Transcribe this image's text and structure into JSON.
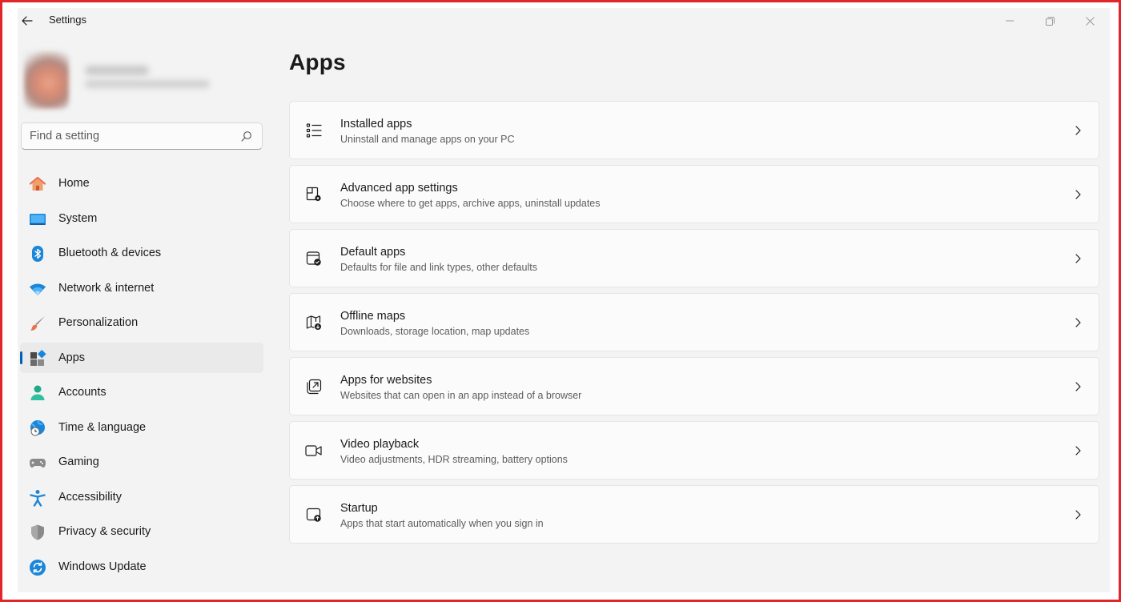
{
  "window": {
    "title": "Settings"
  },
  "search": {
    "placeholder": "Find a setting"
  },
  "sidebar": {
    "items": [
      {
        "label": "Home",
        "icon": "home-icon"
      },
      {
        "label": "System",
        "icon": "system-icon"
      },
      {
        "label": "Bluetooth & devices",
        "icon": "bluetooth-icon"
      },
      {
        "label": "Network & internet",
        "icon": "wifi-icon"
      },
      {
        "label": "Personalization",
        "icon": "brush-icon"
      },
      {
        "label": "Apps",
        "icon": "apps-icon",
        "selected": true
      },
      {
        "label": "Accounts",
        "icon": "person-icon"
      },
      {
        "label": "Time & language",
        "icon": "globe-clock-icon"
      },
      {
        "label": "Gaming",
        "icon": "gamepad-icon"
      },
      {
        "label": "Accessibility",
        "icon": "accessibility-icon"
      },
      {
        "label": "Privacy & security",
        "icon": "shield-icon"
      },
      {
        "label": "Windows Update",
        "icon": "update-icon"
      }
    ]
  },
  "main": {
    "title": "Apps",
    "cards": [
      {
        "title": "Installed apps",
        "subtitle": "Uninstall and manage apps on your PC",
        "icon": "list-icon"
      },
      {
        "title": "Advanced app settings",
        "subtitle": "Choose where to get apps, archive apps, uninstall updates",
        "icon": "app-settings-icon"
      },
      {
        "title": "Default apps",
        "subtitle": "Defaults for file and link types, other defaults",
        "icon": "default-apps-icon"
      },
      {
        "title": "Offline maps",
        "subtitle": "Downloads, storage location, map updates",
        "icon": "map-download-icon"
      },
      {
        "title": "Apps for websites",
        "subtitle": "Websites that can open in an app instead of a browser",
        "icon": "open-in-app-icon"
      },
      {
        "title": "Video playback",
        "subtitle": "Video adjustments, HDR streaming, battery options",
        "icon": "video-camera-icon"
      },
      {
        "title": "Startup",
        "subtitle": "Apps that start automatically when you sign in",
        "icon": "startup-icon"
      }
    ]
  },
  "colors": {
    "accent": "#005fb8",
    "window_bg": "#f3f3f3",
    "card_bg": "#fbfbfb",
    "frame": "#e0262b"
  }
}
